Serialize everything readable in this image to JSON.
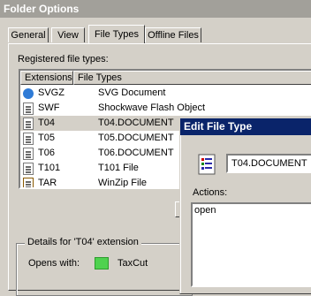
{
  "window": {
    "title": "Folder Options"
  },
  "tabs": [
    {
      "label": "General"
    },
    {
      "label": "View"
    },
    {
      "label": "File Types",
      "active": true
    },
    {
      "label": "Offline Files"
    }
  ],
  "registered_label": "Registered file types:",
  "list": {
    "columns": [
      "Extensions",
      "File Types"
    ],
    "rows": [
      {
        "ext": "SVGZ",
        "type": "SVG Document",
        "icon": "ie-document-icon"
      },
      {
        "ext": "SWF",
        "type": "Shockwave Flash Object",
        "icon": "document-icon"
      },
      {
        "ext": "T04",
        "type": "T04.DOCUMENT",
        "icon": "document-icon",
        "selected": true
      },
      {
        "ext": "T05",
        "type": "T05.DOCUMENT",
        "icon": "document-icon"
      },
      {
        "ext": "T06",
        "type": "T06.DOCUMENT",
        "icon": "document-icon"
      },
      {
        "ext": "T101",
        "type": "T101 File",
        "icon": "document-icon"
      },
      {
        "ext": "TAR",
        "type": "WinZip File",
        "icon": "winzip-icon"
      }
    ]
  },
  "details": {
    "legend": "Details for 'T04' extension",
    "opens_with_label": "Opens with:",
    "app_name": "TaxCut",
    "app_icon_color": "#4fd24f"
  },
  "edit_dialog": {
    "title": "Edit File Type",
    "name_value": "T04.DOCUMENT",
    "actions_label": "Actions:",
    "actions": [
      "open"
    ]
  },
  "colors": {
    "dialog_title_bg": "#0a246a",
    "inactive_title_bg": "#a2a09a",
    "face": "#d4d0c8"
  }
}
